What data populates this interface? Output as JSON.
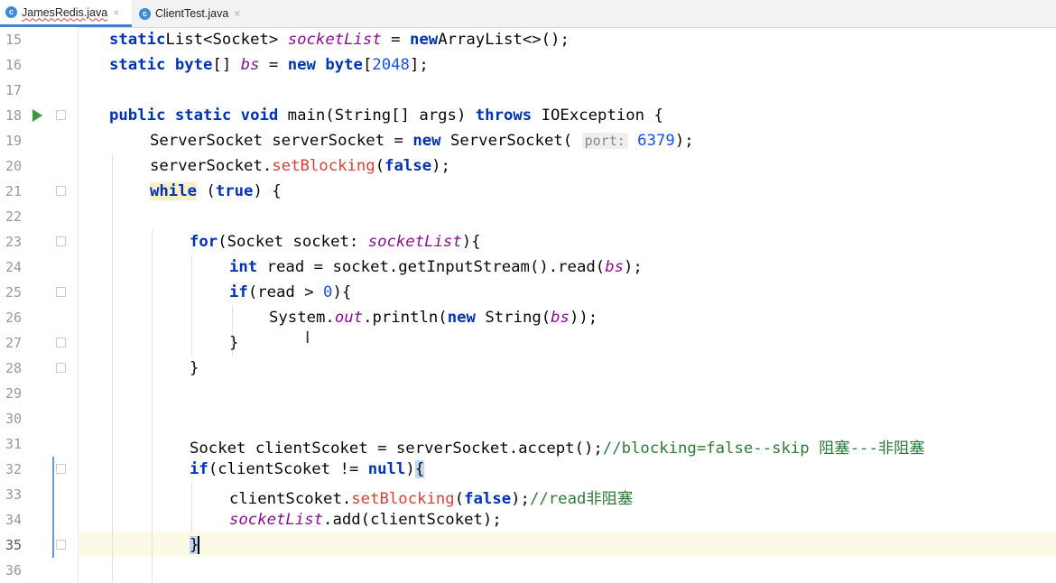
{
  "tabs": [
    {
      "name": "JamesRedis.java",
      "active": true,
      "icon": "class-icon"
    },
    {
      "name": "ClientTest.java",
      "active": false,
      "icon": "class-icon"
    }
  ],
  "tab_close_glyph": "×",
  "lines": [
    {
      "n": "15",
      "tokens": [
        [
          "kw",
          "static"
        ],
        [
          "",
          "List<Socket> "
        ],
        [
          "field",
          "socketList"
        ],
        [
          "",
          " = "
        ],
        [
          "kw",
          "new"
        ],
        [
          "",
          ""
        ],
        [
          "",
          "ArrayList<>();"
        ]
      ]
    },
    {
      "n": "16",
      "tokens": [
        [
          "kw",
          "static byte"
        ],
        [
          "",
          "[] "
        ],
        [
          "field",
          "bs"
        ],
        [
          "",
          " = "
        ],
        [
          "kw",
          "new byte"
        ],
        [
          "",
          "["
        ],
        [
          "num",
          "2048"
        ],
        [
          "",
          "];"
        ]
      ]
    },
    {
      "n": "17",
      "tokens": []
    },
    {
      "n": "18",
      "tokens": [
        [
          "kw",
          "public static void"
        ],
        [
          "",
          " main(String[] args) "
        ],
        [
          "kw",
          "throws"
        ],
        [
          "",
          " IOException {"
        ]
      ]
    },
    {
      "n": "19",
      "tokens": [
        [
          "",
          "ServerSocket serverSocket = "
        ],
        [
          "kw",
          "new"
        ],
        [
          "",
          " ServerSocket( "
        ],
        [
          "hint",
          "port:"
        ],
        [
          "num",
          " 6379"
        ],
        [
          "",
          ");"
        ]
      ]
    },
    {
      "n": "20",
      "tokens": [
        [
          "",
          "serverSocket."
        ],
        [
          "method",
          "setBlocking"
        ],
        [
          "",
          "("
        ],
        [
          "kw",
          "false"
        ],
        [
          "",
          ");"
        ]
      ]
    },
    {
      "n": "21",
      "tokens": [
        [
          "kw hl-while",
          "while"
        ],
        [
          "",
          " ("
        ],
        [
          "kw",
          "true"
        ],
        [
          "",
          ") {"
        ]
      ]
    },
    {
      "n": "22",
      "tokens": []
    },
    {
      "n": "23",
      "tokens": [
        [
          "kw",
          "for"
        ],
        [
          "",
          "(Socket socket: "
        ],
        [
          "field",
          "socketList"
        ],
        [
          "",
          "){"
        ]
      ]
    },
    {
      "n": "24",
      "tokens": [
        [
          "kw",
          "int"
        ],
        [
          "",
          " read = socket.getInputStream().read("
        ],
        [
          "field",
          "bs"
        ],
        [
          "",
          ");"
        ]
      ]
    },
    {
      "n": "25",
      "tokens": [
        [
          "kw",
          "if"
        ],
        [
          "",
          "(read > "
        ],
        [
          "num",
          "0"
        ],
        [
          "",
          "){"
        ]
      ]
    },
    {
      "n": "26",
      "tokens": [
        [
          "",
          "System."
        ],
        [
          "field",
          "out"
        ],
        [
          "",
          ".println("
        ],
        [
          "kw",
          "new"
        ],
        [
          "",
          " String("
        ],
        [
          "field",
          "bs"
        ],
        [
          "",
          "));"
        ]
      ]
    },
    {
      "n": "27",
      "tokens": [
        [
          "",
          "}"
        ]
      ]
    },
    {
      "n": "28",
      "tokens": [
        [
          "",
          "}"
        ]
      ]
    },
    {
      "n": "29",
      "tokens": []
    },
    {
      "n": "30",
      "tokens": []
    },
    {
      "n": "31",
      "tokens": [
        [
          "",
          "Socket clientScoket = serverSocket.accept();"
        ],
        [
          "comment",
          "//blocking=false--skip 阻塞---非阻塞"
        ]
      ]
    },
    {
      "n": "32",
      "tokens": [
        [
          "kw",
          "if"
        ],
        [
          "",
          "(clientScoket != "
        ],
        [
          "kw",
          "null"
        ],
        [
          "",
          ")"
        ],
        [
          "brace-hl",
          "{"
        ]
      ]
    },
    {
      "n": "33",
      "tokens": [
        [
          "",
          "clientScoket."
        ],
        [
          "method",
          "setBlocking"
        ],
        [
          "",
          "("
        ],
        [
          "kw",
          "false"
        ],
        [
          "",
          ");"
        ],
        [
          "comment",
          "//read非阻塞"
        ]
      ]
    },
    {
      "n": "34",
      "tokens": [
        [
          "field",
          "socketList"
        ],
        [
          "",
          ".add(clientScoket);"
        ]
      ]
    },
    {
      "n": "35",
      "tokens": [
        [
          "brace-hl",
          "}"
        ]
      ]
    },
    {
      "n": "36",
      "tokens": []
    }
  ]
}
